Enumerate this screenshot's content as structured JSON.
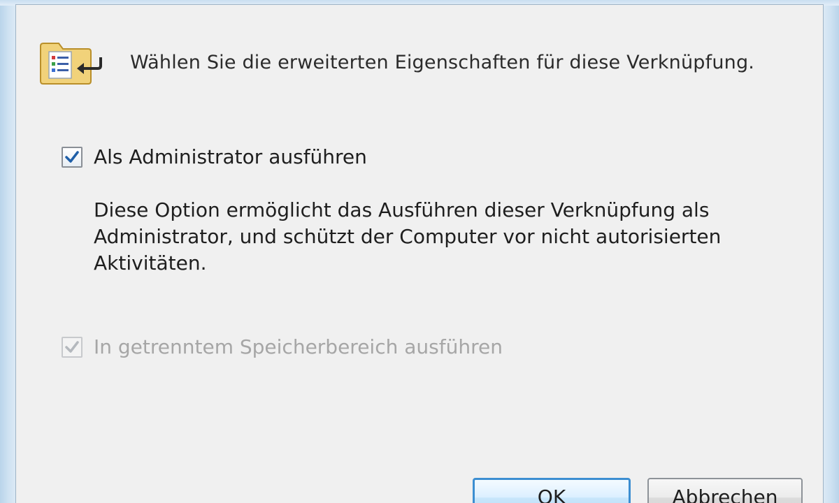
{
  "header": {
    "text": "Wählen Sie die erweiterten Eigenschaften für diese Verknüpfung.",
    "icon": "shortcut-properties-icon"
  },
  "options": {
    "run_as_admin": {
      "label": "Als Administrator ausführen",
      "checked": true,
      "enabled": true
    },
    "description": "Diese Option ermöglicht das Ausführen dieser Verknüpfung als Administrator, und schützt der Computer vor nicht autorisierten Aktivitäten.",
    "separate_memory": {
      "label": "In getrenntem Speicherbereich ausführen",
      "checked": true,
      "enabled": false
    }
  },
  "buttons": {
    "ok": "OK",
    "cancel": "Abbrechen"
  },
  "colors": {
    "dialog_bg": "#f0f0f0",
    "frame": "#cfe2f2",
    "check_mark": "#1f5fa8",
    "disabled_text": "#a6a6a6",
    "ok_border": "#3c8ed1"
  }
}
